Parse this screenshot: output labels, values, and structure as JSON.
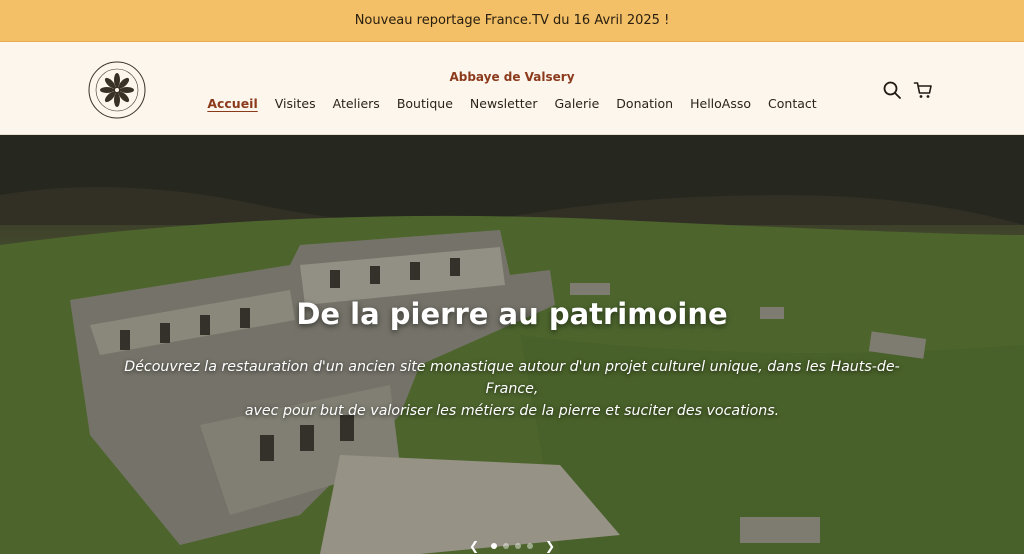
{
  "announcement": {
    "text": "Nouveau reportage France.TV du 16 Avril 2025 !"
  },
  "header": {
    "site_title": "Abbaye de Valsery",
    "nav": [
      {
        "label": "Accueil",
        "active": true
      },
      {
        "label": "Visites"
      },
      {
        "label": "Ateliers"
      },
      {
        "label": "Boutique"
      },
      {
        "label": "Newsletter"
      },
      {
        "label": "Galerie"
      },
      {
        "label": "Donation"
      },
      {
        "label": "HelloAsso"
      },
      {
        "label": "Contact"
      }
    ],
    "icons": [
      "search-icon",
      "cart-icon"
    ]
  },
  "hero": {
    "title": "De la pierre au patrimoine",
    "description_line1": "Découvrez la restauration d'un ancien site monastique autour d'un projet culturel unique, dans les Hauts-de-France,",
    "description_line2": "avec pour but de valoriser les métiers de la pierre et suciter des vocations.",
    "carousel": {
      "slides": 4,
      "active": 1
    }
  }
}
